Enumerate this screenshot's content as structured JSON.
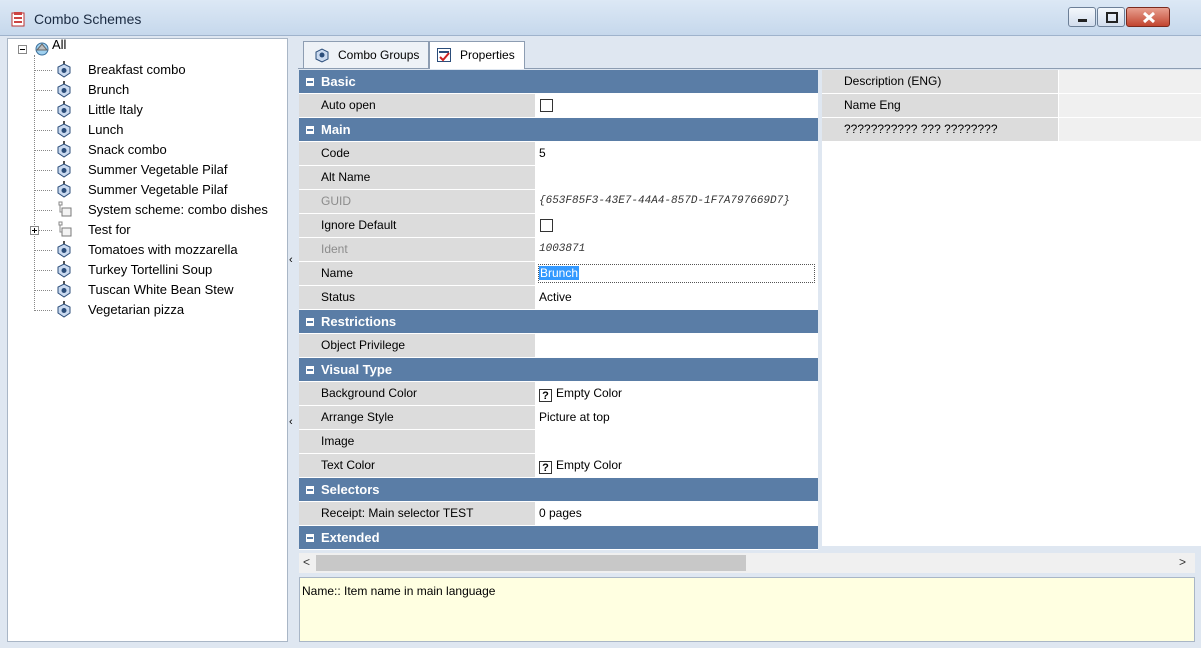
{
  "window": {
    "title": "Combo Schemes"
  },
  "tree": {
    "root": "All",
    "items": [
      "Breakfast combo",
      "Brunch",
      "Little Italy",
      "Lunch",
      "Snack combo",
      "Summer Vegetable Pilaf",
      "Summer Vegetable Pilaf",
      "System scheme: combo dishes",
      "Test for",
      "Tomatoes with mozzarella",
      "Turkey Tortellini Soup",
      "Tuscan White Bean Stew",
      "Vegetarian pizza"
    ]
  },
  "tabs": [
    {
      "label": "Combo Groups",
      "active": false
    },
    {
      "label": "Properties",
      "active": true
    }
  ],
  "properties": {
    "basic": {
      "title": "Basic",
      "auto_open": {
        "label": "Auto open",
        "checked": false
      }
    },
    "main": {
      "title": "Main",
      "code": {
        "label": "Code",
        "value": "5"
      },
      "alt_name": {
        "label": "Alt Name",
        "value": ""
      },
      "guid": {
        "label": "GUID",
        "value": "{653F85F3-43E7-44A4-857D-1F7A797669D7}"
      },
      "ignore_default": {
        "label": "Ignore Default",
        "checked": false
      },
      "ident": {
        "label": "Ident",
        "value": "1003871"
      },
      "name": {
        "label": "Name",
        "value": "Brunch"
      },
      "status": {
        "label": "Status",
        "value": "Active"
      }
    },
    "restrictions": {
      "title": "Restrictions",
      "object_privilege": {
        "label": "Object Privilege",
        "value": ""
      }
    },
    "visual_type": {
      "title": "Visual Type",
      "background_color": {
        "label": "Background Color",
        "value": "Empty Color"
      },
      "arrange_style": {
        "label": "Arrange Style",
        "value": "Picture at top"
      },
      "image": {
        "label": "Image",
        "value": ""
      },
      "text_color": {
        "label": "Text Color",
        "value": "Empty Color"
      }
    },
    "selectors": {
      "title": "Selectors",
      "receipt": {
        "label": "Receipt: Main selector TEST",
        "value": "0 pages"
      }
    },
    "extended": {
      "title": "Extended"
    }
  },
  "language_panel": [
    {
      "label": "Description (ENG)",
      "value": ""
    },
    {
      "label": "Name Eng",
      "value": ""
    },
    {
      "label": "??????????? ??? ????????",
      "value": ""
    }
  ],
  "description_text": "Name:: Item name in main language",
  "question_mark": "?",
  "colors": {
    "category": "#5a7da6",
    "selection": "#3399ff",
    "hint_bg": "#ffffe1"
  }
}
